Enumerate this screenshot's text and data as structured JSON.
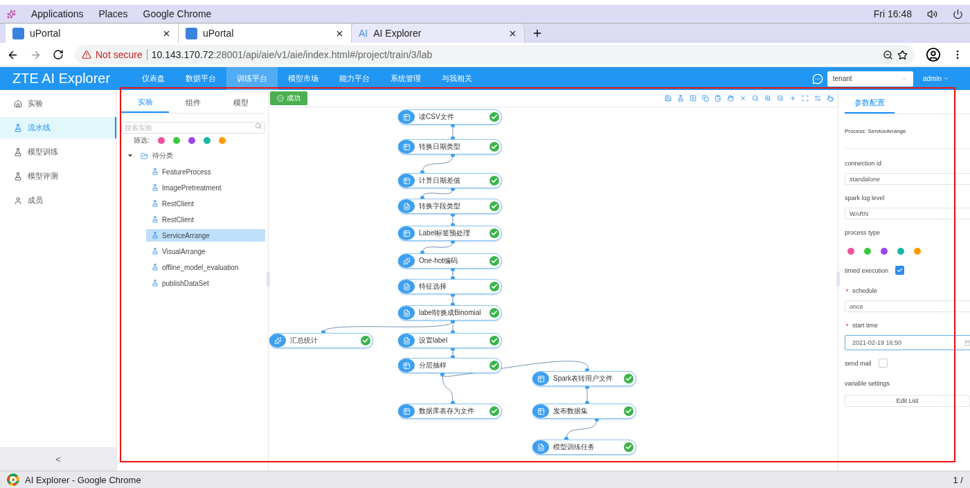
{
  "desktop_bar": {
    "menus": [
      "Applications",
      "Places",
      "Google Chrome"
    ],
    "clock": "Fri 16:48"
  },
  "browser": {
    "tabs": [
      {
        "title": "uPortal",
        "kind": "portal",
        "selected": false
      },
      {
        "title": "uPortal",
        "kind": "portal",
        "selected": false
      },
      {
        "title": "AI Explorer",
        "kind": "ai",
        "badge": "AI",
        "selected": true
      }
    ],
    "security": "Not secure",
    "url_host": "10.143.170.72",
    "url_rest": ":28001/api/aie/v1/aie/index.html#/project/train/3/lab"
  },
  "app": {
    "logo": "ZTE AI Explorer",
    "nav": [
      {
        "label": "仪表盘",
        "selected": false
      },
      {
        "label": "数据平台",
        "selected": false
      },
      {
        "label": "训练平台",
        "selected": true
      },
      {
        "label": "模型市场",
        "selected": false
      },
      {
        "label": "能力平台",
        "selected": false
      },
      {
        "label": "系统管理",
        "selected": false
      },
      {
        "label": "与我相关",
        "selected": false
      }
    ],
    "tenant": "tenant",
    "user": "admin"
  },
  "sidebar": {
    "items": [
      {
        "label": "实验",
        "kind": "home",
        "selected": false
      },
      {
        "label": "流水线",
        "kind": "flask",
        "selected": true
      },
      {
        "label": "模型训练",
        "kind": "flask",
        "selected": false
      },
      {
        "label": "模型评测",
        "kind": "flask",
        "selected": false
      },
      {
        "label": "成员",
        "kind": "user",
        "selected": false
      }
    ],
    "collapse": "<"
  },
  "library": {
    "tabs": [
      {
        "label": "实验",
        "selected": true
      },
      {
        "label": "组件",
        "selected": false
      },
      {
        "label": "模型",
        "selected": false
      }
    ],
    "search_placeholder": "搜索实验",
    "filter_label": "筛选:",
    "filter_colors": [
      {
        "color": "#f0509e"
      },
      {
        "color": "#3cc83c"
      },
      {
        "color": "#9b44f0"
      },
      {
        "color": "#1ab5a5"
      },
      {
        "color": "#ff9a00"
      }
    ],
    "folder": {
      "label": "待分类",
      "expanded": true,
      "children": [
        {
          "label": "FeatureProcess",
          "selected": false
        },
        {
          "label": "ImagePretreatment",
          "selected": false
        },
        {
          "label": "RestClient",
          "selected": false
        },
        {
          "label": "RestClient",
          "selected": false
        },
        {
          "label": "ServiceArrange",
          "selected": true
        },
        {
          "label": "VisualArrange",
          "selected": false
        },
        {
          "label": "offline_model_evaluation",
          "selected": false
        },
        {
          "label": "publishDataSet",
          "selected": false
        }
      ]
    }
  },
  "canvas": {
    "status": "成功",
    "nodes": [
      {
        "label": "读CSV文件",
        "kind": "table",
        "done": true
      },
      {
        "label": "转换日期类型",
        "kind": "table",
        "done": true
      },
      {
        "label": "计算日期差值",
        "kind": "table",
        "done": true
      },
      {
        "label": "转换字段类型",
        "kind": "doc",
        "done": true
      },
      {
        "label": "Label标签预处理",
        "kind": "table",
        "done": true
      },
      {
        "label": "One-hot编码",
        "kind": "script",
        "done": true
      },
      {
        "label": "特征选择",
        "kind": "doc",
        "done": true
      },
      {
        "label": "label转换成Binomial",
        "kind": "doc",
        "done": true
      },
      {
        "label": "汇总统计",
        "kind": "script",
        "done": true
      },
      {
        "label": "设置label",
        "kind": "doc",
        "done": true
      },
      {
        "label": "分层抽样",
        "kind": "table",
        "done": true
      },
      {
        "label": "Spark表转用户文件",
        "kind": "table",
        "done": true
      },
      {
        "label": "数据库表存为文件",
        "kind": "table",
        "done": true
      },
      {
        "label": "发布数据集",
        "kind": "table",
        "done": true
      },
      {
        "label": "模型训练任务",
        "kind": "doc",
        "done": true
      }
    ],
    "status_ok": true
  },
  "params": {
    "tab": "参数配置",
    "process": "Process: ServiceArrange",
    "fields": [
      {
        "kind": "select",
        "label": "connection id",
        "value": "standalone"
      },
      {
        "kind": "select",
        "label": "spark log level",
        "value": "WARN"
      },
      {
        "kind": "colors",
        "label": "process type",
        "colors": [
          {
            "color": "#f0509e"
          },
          {
            "color": "#3cc83c"
          },
          {
            "color": "#9b44f0"
          },
          {
            "color": "#1ab5a5"
          },
          {
            "color": "#ff9a00"
          }
        ]
      },
      {
        "kind": "checkbox",
        "label": "timed execution",
        "checked": true
      },
      {
        "kind": "select",
        "label": "schedule",
        "required": true,
        "value": "once"
      },
      {
        "kind": "date",
        "label": "start time",
        "required": true,
        "value": "2021-02-19 16:50"
      },
      {
        "kind": "checkbox",
        "label": "send mail",
        "checked": false
      },
      {
        "kind": "button",
        "label": "variable settings",
        "button": "Edit List"
      }
    ]
  },
  "taskbar": {
    "window": "AI Explorer - Google Chrome",
    "pager": "1 /"
  }
}
